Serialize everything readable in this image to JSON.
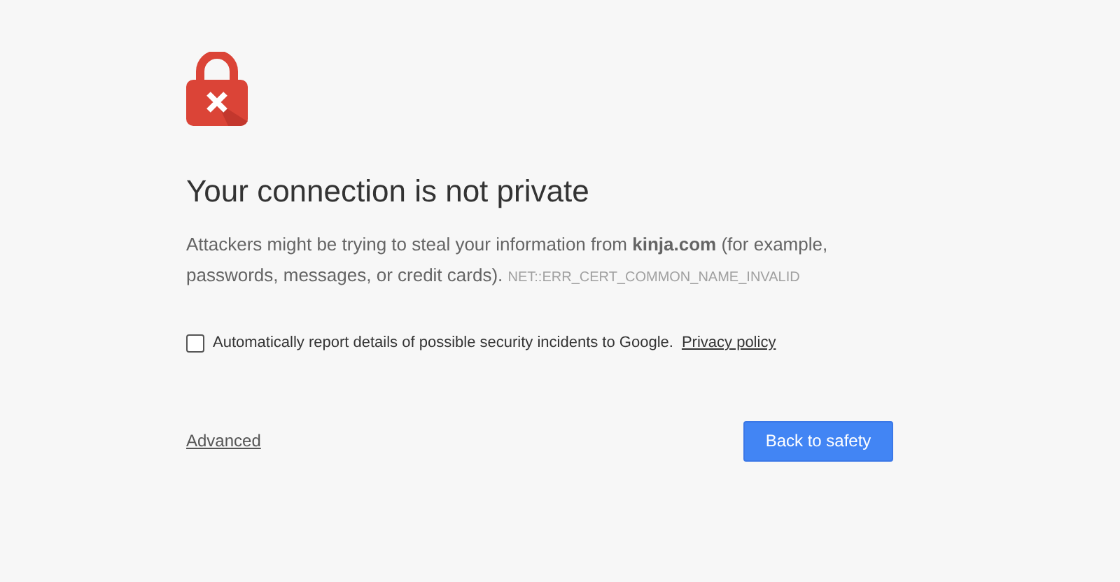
{
  "page": {
    "title": "Your connection is not private",
    "body": "Attackers might be trying to steal your information from **kinja.com** (for example, passwords, messages, or credit cards).",
    "error_code": "NET::ERR_CERT_COMMON_NAME_INVALID",
    "report_checkbox": {
      "label": "Automatically report details of possible security incidents to Google.",
      "checked": false,
      "link": "Privacy policy"
    },
    "advanced_link": "Advanced",
    "primary_button": "Back to safety"
  }
}
